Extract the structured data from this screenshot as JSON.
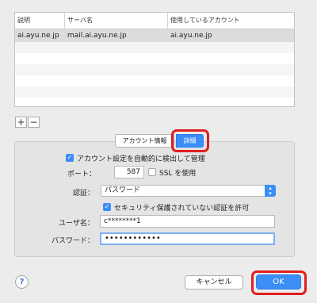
{
  "table": {
    "headers": [
      "説明",
      "サーバ名",
      "使用しているアカウント"
    ],
    "rows": [
      [
        "ai.ayu.ne.jp",
        "mail.ai.ayu.ne.jp",
        "ai.ayu.ne.jp"
      ]
    ]
  },
  "add_label": "+",
  "remove_label": "−",
  "tabs": {
    "info": "アカウント情報",
    "detail": "詳細"
  },
  "detail": {
    "auto_detect_label": "アカウント設定を自動的に検出して管理",
    "port_label": "ポート：",
    "port_value": "587",
    "ssl_label": "SSL を使用",
    "auth_label": "認証：",
    "auth_value": "パスワード",
    "allow_insecure_label": "セキュリティ保護されていない認証を許可",
    "username_label": "ユーザ名：",
    "username_value": "c********1",
    "password_label": "パスワード：",
    "password_value": "••••••••••••"
  },
  "help_label": "?",
  "cancel_label": "キャンセル",
  "ok_label": "OK",
  "colors": {
    "accent": "#3b8ef5",
    "highlight": "#e01e1e"
  }
}
